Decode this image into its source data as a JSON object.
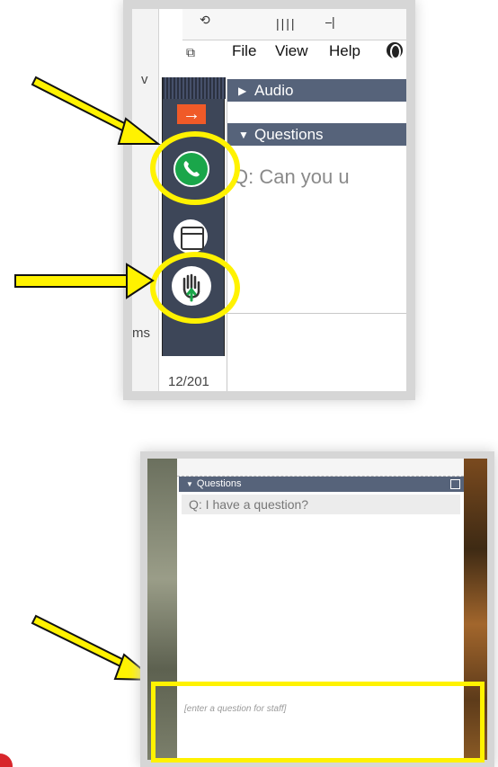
{
  "colors": {
    "highlight": "#fff200",
    "pane_header": "#56637a",
    "toolbar": "#3d4658",
    "phone_button": "#1aa64a",
    "arrow_button": "#f05a28"
  },
  "top_screenshot": {
    "menu": [
      "File",
      "View",
      "Help"
    ],
    "menu_icon": "globe-icon",
    "panes": [
      {
        "label": "Audio",
        "state": "collapsed"
      },
      {
        "label": "Questions",
        "state": "expanded"
      }
    ],
    "question_preview": "Q: Can you u",
    "side_toolbar": {
      "buttons": [
        {
          "name": "arrow-icon",
          "glyph": "→"
        },
        {
          "name": "phone-icon"
        },
        {
          "name": "window-icon"
        },
        {
          "name": "raise-hand-icon"
        }
      ]
    },
    "edge_text": {
      "v": "v",
      "ms": "ms",
      "date": "12/201"
    }
  },
  "bottom_screenshot": {
    "pane_header": "Questions",
    "question": "Q: I have a question?",
    "input_placeholder": "[enter a question for staff]"
  }
}
